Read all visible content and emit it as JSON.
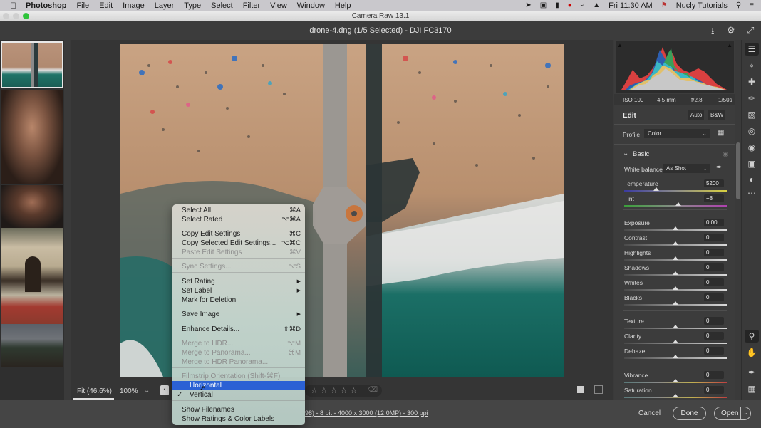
{
  "menubar": {
    "app_name": "Photoshop",
    "items": [
      "File",
      "Edit",
      "Image",
      "Layer",
      "Type",
      "Select",
      "Filter",
      "View",
      "Window",
      "Help"
    ],
    "clock": "Fri 11:30 AM",
    "user": "Nucly Tutorials"
  },
  "window": {
    "title": "Camera Raw 13.1",
    "document": "drone-4.dng (1/5 Selected)  -  DJI FC3170"
  },
  "histogram": {
    "iso": "ISO 100",
    "focal_length": "4.5 mm",
    "aperture": "f/2.8",
    "shutter": "1/50s"
  },
  "edit": {
    "title": "Edit",
    "auto_label": "Auto",
    "bw_label": "B&W",
    "profile_label": "Profile",
    "profile_value": "Color",
    "basic_title": "Basic",
    "white_balance_label": "White balance",
    "white_balance_value": "As Shot",
    "sliders": [
      {
        "label": "Temperature",
        "value": "5200",
        "position": 0.31
      },
      {
        "label": "Tint",
        "value": "+8",
        "position": 0.53
      },
      {
        "label": "Exposure",
        "value": "0.00",
        "position": 0.5
      },
      {
        "label": "Contrast",
        "value": "0",
        "position": 0.5
      },
      {
        "label": "Highlights",
        "value": "0",
        "position": 0.5
      },
      {
        "label": "Shadows",
        "value": "0",
        "position": 0.5
      },
      {
        "label": "Whites",
        "value": "0",
        "position": 0.5
      },
      {
        "label": "Blacks",
        "value": "0",
        "position": 0.5
      },
      {
        "label": "Texture",
        "value": "0",
        "position": 0.5
      },
      {
        "label": "Clarity",
        "value": "0",
        "position": 0.5
      },
      {
        "label": "Dehaze",
        "value": "0",
        "position": 0.5
      },
      {
        "label": "Vibrance",
        "value": "0",
        "position": 0.5
      },
      {
        "label": "Saturation",
        "value": "0",
        "position": 0.5
      }
    ]
  },
  "zoombar": {
    "fit_label": "Fit (46.6%)",
    "zoom_value": "100%",
    "rating_stars": 0
  },
  "footer": {
    "info_link": "98) - 8 bit - 4000 x 3000 (12.0MP) - 300 ppi",
    "cancel_label": "Cancel",
    "done_label": "Done",
    "open_label": "Open"
  },
  "filmstrip": {
    "thumbnails": [
      "drone-4",
      "portrait-veil",
      "portrait-curly",
      "building",
      "landscape"
    ],
    "selected_index": 0
  },
  "context_menu": {
    "items": [
      {
        "label": "Select All",
        "shortcut": "⌘A",
        "disabled": false
      },
      {
        "label": "Select Rated",
        "shortcut": "⌥⌘A",
        "disabled": false
      },
      {
        "label": "Copy Edit Settings",
        "shortcut": "⌘C",
        "disabled": false
      },
      {
        "label": "Copy Selected Edit Settings...",
        "shortcut": "⌥⌘C",
        "disabled": false
      },
      {
        "label": "Paste Edit Settings",
        "shortcut": "⌘V",
        "disabled": true
      },
      {
        "label": "Sync Settings...",
        "shortcut": "⌥S",
        "disabled": true
      },
      {
        "label": "Set Rating",
        "shortcut": "▶",
        "disabled": false
      },
      {
        "label": "Set Label",
        "shortcut": "▶",
        "disabled": false
      },
      {
        "label": "Mark for Deletion",
        "shortcut": "",
        "disabled": false
      },
      {
        "label": "Save Image",
        "shortcut": "▶",
        "disabled": false
      },
      {
        "label": "Enhance Details...",
        "shortcut": "⇧⌘D",
        "disabled": false
      },
      {
        "label": "Merge to HDR...",
        "shortcut": "⌥M",
        "disabled": true
      },
      {
        "label": "Merge to Panorama...",
        "shortcut": "⌘M",
        "disabled": true
      },
      {
        "label": "Merge to HDR Panorama...",
        "shortcut": "",
        "disabled": true
      },
      {
        "label": "Filmstrip Orientation (Shift-⌘F)",
        "shortcut": "",
        "disabled": true
      },
      {
        "label": "Horizontal",
        "shortcut": "",
        "disabled": false,
        "highlighted": true
      },
      {
        "label": "Vertical",
        "shortcut": "",
        "disabled": false,
        "checked": true
      },
      {
        "label": "Show Filenames",
        "shortcut": "",
        "disabled": false
      },
      {
        "label": "Show Ratings & Color Labels",
        "shortcut": "",
        "disabled": false
      }
    ],
    "check_mark": "✓"
  },
  "colors": {
    "highlight": "#2b61d4",
    "panel_bg": "#3c3c3c"
  }
}
